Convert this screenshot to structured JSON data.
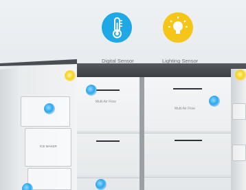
{
  "sensors": {
    "temperature": {
      "label": "Digital Sensor",
      "icon": "thermometer-icon",
      "color": "#1ea8e6"
    },
    "lighting": {
      "label": "Lighting Sensor",
      "icon": "light-bulb-icon",
      "color": "#f5c518"
    }
  },
  "fridge": {
    "left_compartment_label": "Multi Air Flow",
    "right_compartment_label": "Multi Air Flow",
    "door_label": "ICE MAKER"
  }
}
